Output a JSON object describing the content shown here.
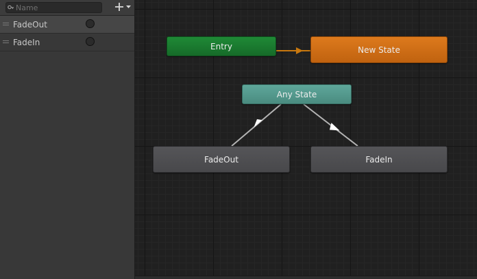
{
  "parameters_panel": {
    "search": {
      "placeholder": "Name",
      "value": "",
      "icon": "search-icon"
    },
    "add_button_icon": "plus-dropdown-icon",
    "items": [
      {
        "name": "FadeOut",
        "type": "trigger",
        "selected": true
      },
      {
        "name": "FadeIn",
        "type": "trigger",
        "selected": false
      }
    ]
  },
  "graph": {
    "nodes": {
      "entry": {
        "label": "Entry",
        "color": "#1f8a36"
      },
      "new_state": {
        "label": "New State",
        "color": "#dd7a1d",
        "is_default": true
      },
      "any_state": {
        "label": "Any State",
        "color": "#5ea79a"
      },
      "fadeout": {
        "label": "FadeOut",
        "color": "#505053"
      },
      "fadein": {
        "label": "FadeIn",
        "color": "#505053"
      }
    },
    "transitions": [
      {
        "from": "Entry",
        "to": "New State",
        "color": "#c8780f"
      },
      {
        "from": "Any State",
        "to": "FadeOut",
        "color": "#b4b4b4"
      },
      {
        "from": "Any State",
        "to": "FadeIn",
        "color": "#b4b4b4"
      }
    ]
  }
}
